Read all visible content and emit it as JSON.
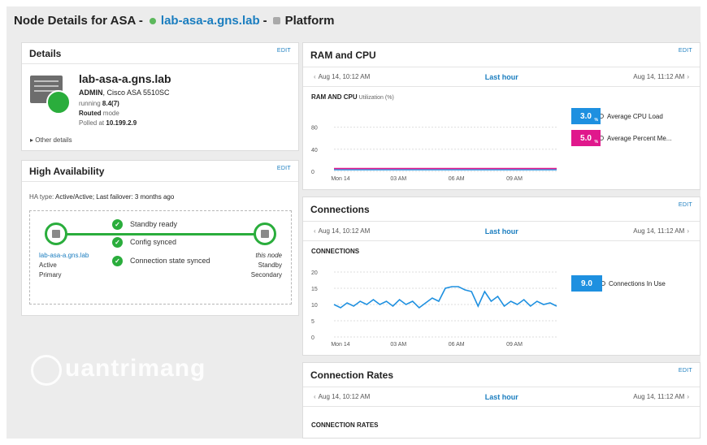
{
  "header": {
    "prefix": "Node Details for ASA -",
    "node": "lab-asa-a.gns.lab",
    "sep": "-",
    "platform": "Platform",
    "status_color": "#5cb85c"
  },
  "edit_label": "EDIT",
  "details": {
    "title": "Details",
    "name": "lab-asa-a.gns.lab",
    "role": "ADMIN",
    "model": ", Cisco ASA 5510SC",
    "running_label": "running",
    "version": "8.4(7)",
    "mode": "Routed",
    "mode_suffix": "mode",
    "polled_label": "Polled at",
    "ip": "10.199.2.9",
    "other": "Other details"
  },
  "ha": {
    "title": "High Availability",
    "type_label": "HA type:",
    "type_value": "Active/Active; Last failover: 3 months ago",
    "checks": [
      "Standby ready",
      "Config synced",
      "Connection state synced"
    ],
    "left": {
      "name": "lab-asa-a.gns.lab",
      "state": "Active",
      "role": "Primary"
    },
    "right": {
      "name": "this node",
      "state": "Standby",
      "role": "Secondary"
    }
  },
  "timebar": {
    "start": "Aug 14, 10:12 AM",
    "range": "Last hour",
    "end": "Aug 14, 11:12 AM"
  },
  "ram": {
    "title": "RAM and CPU",
    "chart_label": "RAM AND CPU",
    "chart_sub": "Utilization (%)",
    "legend": [
      {
        "value": "3.0",
        "unit": "%",
        "label": "Average CPU Load",
        "color": "#1e90e0"
      },
      {
        "value": "5.0",
        "unit": "%",
        "label": "Average Percent Me...",
        "color": "#e0188c"
      }
    ]
  },
  "connections": {
    "title": "Connections",
    "chart_label": "CONNECTIONS",
    "legend": {
      "value": "9.0",
      "label": "Connections In Use",
      "color": "#1e90e0"
    }
  },
  "rates": {
    "title": "Connection Rates",
    "chart_label": "CONNECTION RATES"
  },
  "watermark": "uantrimang",
  "chart_data": [
    {
      "type": "line",
      "title": "RAM AND CPU",
      "ylabel": "Utilization (%)",
      "yticks": [
        0,
        40,
        80
      ],
      "ylim": [
        0,
        100
      ],
      "xticks": [
        "Mon 14",
        "03 AM",
        "06 AM",
        "09 AM"
      ],
      "series": [
        {
          "name": "Average CPU Load",
          "color": "#1e90e0",
          "values": [
            3,
            3,
            3,
            3,
            3,
            3,
            3,
            3,
            3,
            3,
            3,
            3
          ]
        },
        {
          "name": "Average Percent Me...",
          "color": "#e0188c",
          "values": [
            5,
            5,
            5,
            5,
            5,
            5,
            5,
            5,
            5,
            5,
            5,
            5
          ]
        }
      ]
    },
    {
      "type": "line",
      "title": "CONNECTIONS",
      "yticks": [
        0,
        5,
        10,
        15,
        20
      ],
      "ylim": [
        0,
        20
      ],
      "xticks": [
        "Mon 14",
        "03 AM",
        "06 AM",
        "09 AM"
      ],
      "series": [
        {
          "name": "Connections In Use",
          "color": "#1e90e0",
          "values": [
            10,
            9,
            10.5,
            9.5,
            11,
            10,
            11.5,
            10,
            11,
            9.5,
            11.5,
            10,
            11,
            9,
            10.5,
            12,
            11,
            15,
            15.5,
            15.5,
            14.5,
            14,
            9.5,
            14,
            11,
            12.5,
            9.5,
            11,
            10,
            11.5,
            9.5,
            11,
            10,
            10.5,
            9.5
          ]
        }
      ]
    }
  ]
}
